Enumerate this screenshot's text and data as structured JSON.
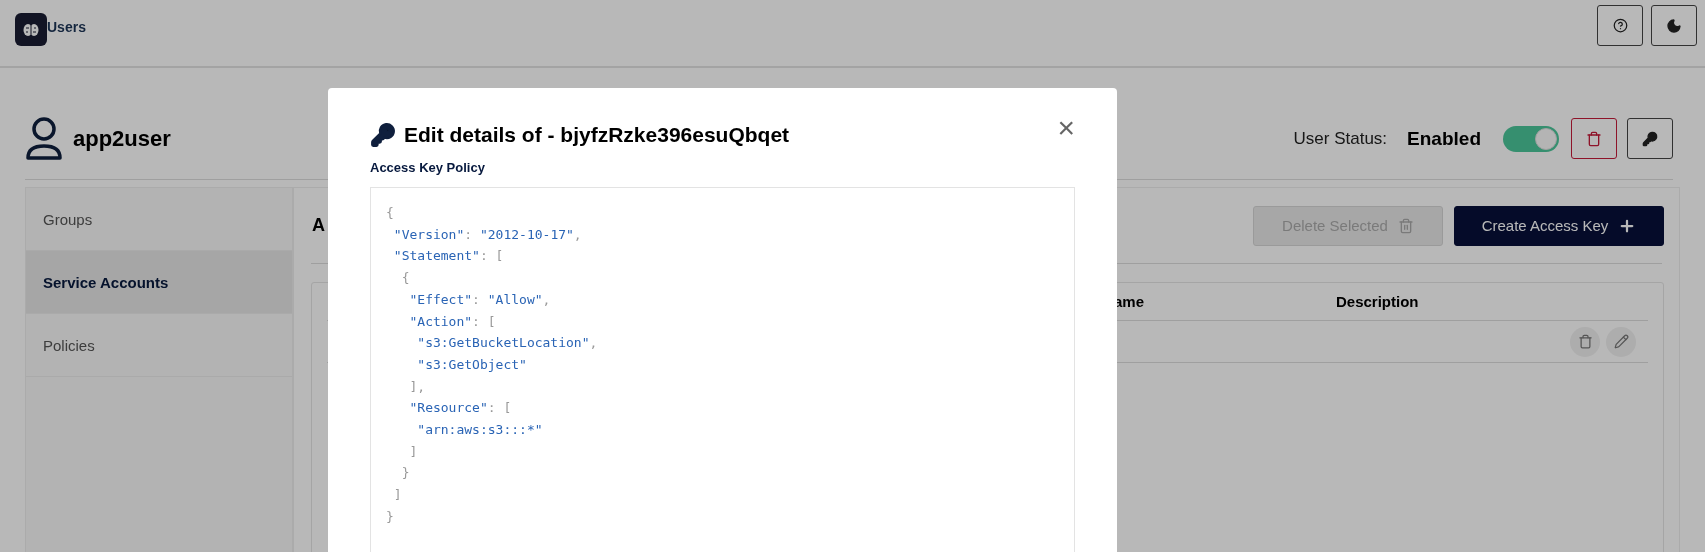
{
  "top_bar": {
    "title": "Users"
  },
  "user": {
    "name": "app2user",
    "status_label": "User Status:",
    "status_value": "Enabled",
    "on": true
  },
  "sidebar": {
    "items": [
      {
        "label": "Groups",
        "selected": false
      },
      {
        "label": "Service Accounts",
        "selected": true
      },
      {
        "label": "Policies",
        "selected": false
      }
    ]
  },
  "panel": {
    "heading": "A",
    "buttons": [
      {
        "label": "Delete Selected",
        "disabled": true,
        "kind": "delete"
      },
      {
        "label": "Create Access Key",
        "disabled": false,
        "kind": "create"
      }
    ]
  },
  "table": {
    "columns": [
      "ame",
      "Description"
    ]
  },
  "modal": {
    "title": "Edit details of - bjyfzRzke396esuQbqet",
    "close": "×",
    "field_label": "Access Key Policy",
    "code": [
      "{",
      " \"Version\": \"2012-10-17\",",
      " \"Statement\": [",
      "  {",
      "   \"Effect\": \"Allow\",",
      "   \"Action\": [",
      "    \"s3:GetBucketLocation\",",
      "    \"s3:GetObject\"",
      "   ],",
      "   \"Resource\": [",
      "    \"arn:aws:s3:::*\"",
      "   ]",
      "  }",
      " ]",
      "}"
    ]
  }
}
